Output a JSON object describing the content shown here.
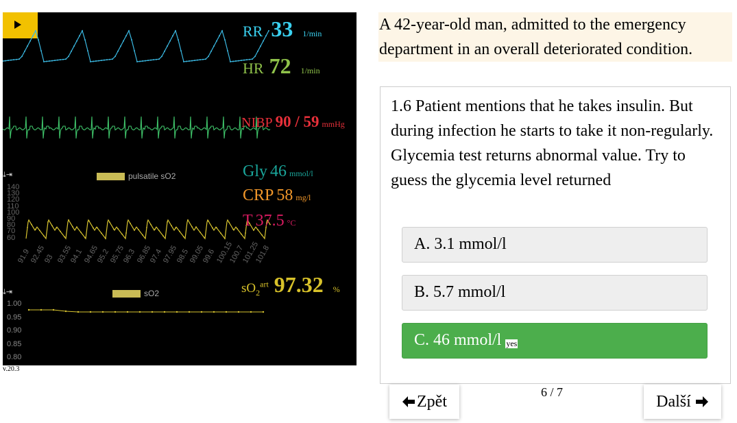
{
  "monitor": {
    "play_icon": "play-icon",
    "vitals": {
      "rr": {
        "label": "RR",
        "value": "33",
        "unit": "1/min",
        "color": "#3ad1f0"
      },
      "hr": {
        "label": "HR",
        "value": "72",
        "unit": "1/min",
        "color": "#8fc24a"
      },
      "nibp": {
        "label": "NIBP",
        "value": "90 / 59",
        "unit": "mmHg",
        "color": "#e8303a"
      },
      "gly": {
        "label": "Gly",
        "value": "46",
        "unit": "mmol/l",
        "color": "#1aa59a"
      },
      "crp": {
        "label": "CRP",
        "value": "58",
        "unit": "mg/l",
        "color": "#f0962a"
      },
      "temp": {
        "label": "T",
        "value": "37.5",
        "unit": "°C",
        "color": "#d81b60"
      },
      "so2": {
        "label_main": "sO",
        "label_sub": "2",
        "label_sup": "art",
        "value": "97.32",
        "unit": "%",
        "color": "#d8c22a"
      }
    },
    "pulsatile_chart": {
      "legend": "pulsatile sO2",
      "icons": [
        "download-icon",
        "export-icon"
      ],
      "y_ticks": [
        "140",
        "130",
        "120",
        "110",
        "100",
        "90",
        "80",
        "70",
        "60"
      ],
      "x_ticks": [
        "91.9",
        "92.45",
        "93",
        "93.55",
        "94.1",
        "94.65",
        "95.2",
        "95.75",
        "96.3",
        "96.85",
        "97.4",
        "97.95",
        "98.5",
        "99.05",
        "99.6",
        "100.15",
        "100.7",
        "101.25",
        "101.8"
      ]
    },
    "so2_chart": {
      "legend": "sO2",
      "icons": [
        "download-icon",
        "export-icon"
      ],
      "y_ticks": [
        "1.00",
        "0.95",
        "0.90",
        "0.85",
        "0.80"
      ]
    },
    "version": "v.20.3"
  },
  "intro": {
    "line1": "A 42-year-old man, admitted to the emergency",
    "line2": "department in an overall deteriorated condition."
  },
  "question": {
    "text": "1.6 Patient mentions that he takes insulin. But during infection he starts to take it non-regularly. Glycemia test returns abnormal value. Try to guess the glycemia level returned",
    "options": [
      {
        "label": "A. 3.1 mmol/l",
        "state": "default"
      },
      {
        "label": "B. 5.7 mmol/l",
        "state": "default"
      },
      {
        "label": "C. 46 mmol/l",
        "state": "correct",
        "tag": "yes"
      }
    ]
  },
  "nav": {
    "back_label": "Zpět",
    "next_label": "Další",
    "page": "6 / 7",
    "back_icon": "arrow-left-icon",
    "next_icon": "arrow-right-icon"
  }
}
